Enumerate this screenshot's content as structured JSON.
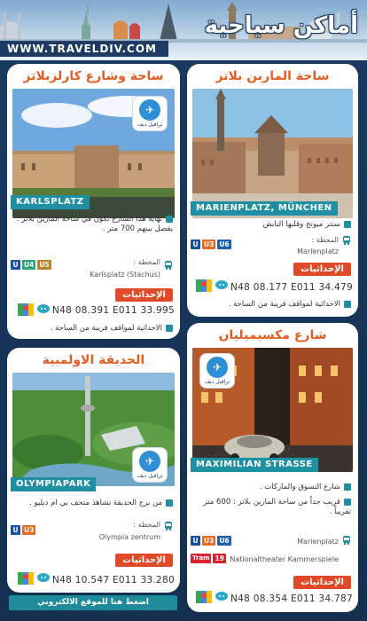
{
  "header": {
    "title": "أماكن سياحية",
    "site": "WWW.TRAVELDIV.COM"
  },
  "logo_label": "ترافيل ديف",
  "common": {
    "station_label": "المحطة :",
    "coords_button": "الإحداثيات"
  },
  "places": {
    "marienplatz": {
      "title": "ساحة المارين بلاتز",
      "tag": "MARIENPLATZ, MÜNCHEN",
      "desc": "سنتر ميونخ وقلبها النابض",
      "station": "Marienplatz",
      "lines": [
        "U",
        "U3",
        "U6"
      ],
      "coords": "N48 08.177 E011 34.479",
      "parking": "الاحداثية لمواقف قريبة من الساحة ."
    },
    "karlsplatz": {
      "title": "ساحة وشارع كارلزبلاتز",
      "tag": "KARLSPLATZ",
      "desc": "نهاية هذا الشارع تكون في ساحة المارين بلاتز : يفصل بينهم 700 متر .",
      "station": "Karlsplatz (Stachus)",
      "lines": [
        "U",
        "U4",
        "U5"
      ],
      "coords": "N48 08.391 E011 33.995",
      "parking": "الاحداثية لمواقف قريبة من الساحة ."
    },
    "maximilian": {
      "title": "شارع مكسيميليان",
      "tag": "MAXIMILIAN STRASSE",
      "desc1": "شارع التسوق والماركات .",
      "desc2": "قريب جداً من ساحة المارين بلاتز : 600 متر تقريباً .",
      "station1": "Marienplatz",
      "lines1": [
        "U",
        "U3",
        "U6"
      ],
      "station2": "Nationaltheater Kammerspiele",
      "lines2": [
        "Tram",
        "19"
      ],
      "coords": "N48 08.354 E011 34.787"
    },
    "olympiapark": {
      "title": "الحديقة الاولمبية",
      "tag": "OLYMPIAPARK",
      "desc": "من برج الحديقة تشاهد متحف بي ام دبليو .",
      "station": "Olympia zentrum",
      "lines": [
        "U",
        "U3"
      ],
      "coords": "N48 10.547 E011 33.280"
    }
  },
  "footer": "اضغط هنا للموقع الالكتروني",
  "colors": {
    "background": "#16355a",
    "title_orange": "#e35d22",
    "teal": "#1f8fa3",
    "coords_red": "#e04a28"
  }
}
